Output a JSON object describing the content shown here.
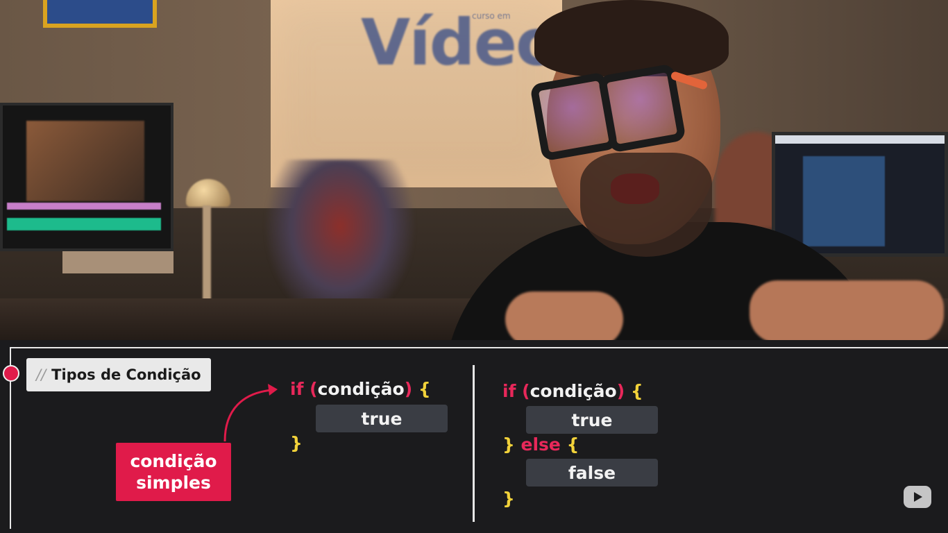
{
  "video": {
    "logo_text": "Vídeo",
    "logo_small_text": "curso em"
  },
  "slide": {
    "title_prefix": "//",
    "title": "Tipos de Condição",
    "annotation_line1": "condição",
    "annotation_line2": "simples",
    "simple": {
      "if_keyword": "if",
      "open_paren": "(",
      "condition": "condição",
      "close_paren": ")",
      "open_brace": "{",
      "true_value": "true",
      "close_brace": "}"
    },
    "composite": {
      "if_keyword": "if",
      "open_paren": "(",
      "condition": "condição",
      "close_paren": ")",
      "open_brace": "{",
      "true_value": "true",
      "else_close_brace": "}",
      "else_keyword": "else",
      "else_open_brace": "{",
      "false_value": "false",
      "close_brace": "}"
    }
  },
  "colors": {
    "accent_red": "#e01b4a",
    "brace_yellow": "#f2d23a",
    "slide_bg": "#1b1b1d"
  },
  "icons": {
    "player_logo": "youtube-play-icon",
    "arrow": "curved-arrow-icon"
  }
}
